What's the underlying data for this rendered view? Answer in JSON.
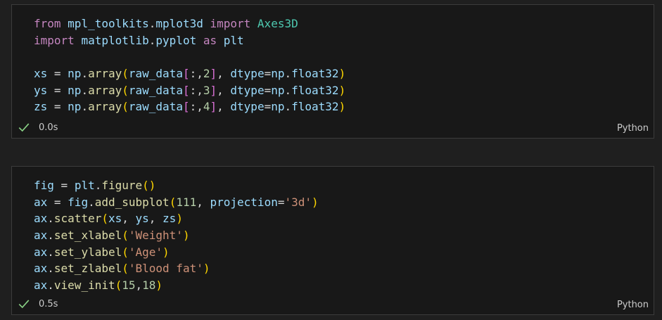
{
  "cells": [
    {
      "lines": [
        [
          [
            "kw",
            "from"
          ],
          [
            "op",
            " "
          ],
          [
            "txt",
            "mpl_toolkits"
          ],
          [
            "op",
            "."
          ],
          [
            "txt",
            "mplot3d"
          ],
          [
            "op",
            " "
          ],
          [
            "kw",
            "import"
          ],
          [
            "op",
            " "
          ],
          [
            "mod",
            "Axes3D"
          ]
        ],
        [
          [
            "kw",
            "import"
          ],
          [
            "op",
            " "
          ],
          [
            "txt",
            "matplotlib"
          ],
          [
            "op",
            "."
          ],
          [
            "txt",
            "pyplot"
          ],
          [
            "op",
            " "
          ],
          [
            "kw",
            "as"
          ],
          [
            "op",
            " "
          ],
          [
            "txt",
            "plt"
          ]
        ],
        [
          [
            "op",
            " "
          ]
        ],
        [
          [
            "txt",
            "xs"
          ],
          [
            "op",
            " = "
          ],
          [
            "txt",
            "np"
          ],
          [
            "op",
            "."
          ],
          [
            "fn",
            "array"
          ],
          [
            "p1",
            "("
          ],
          [
            "txt",
            "raw_data"
          ],
          [
            "p2",
            "["
          ],
          [
            "op",
            ":,"
          ],
          [
            "num",
            "2"
          ],
          [
            "p2",
            "]"
          ],
          [
            "op",
            ", "
          ],
          [
            "txt",
            "dtype"
          ],
          [
            "op",
            "="
          ],
          [
            "txt",
            "np"
          ],
          [
            "op",
            "."
          ],
          [
            "txt",
            "float32"
          ],
          [
            "p1",
            ")"
          ]
        ],
        [
          [
            "txt",
            "ys"
          ],
          [
            "op",
            " = "
          ],
          [
            "txt",
            "np"
          ],
          [
            "op",
            "."
          ],
          [
            "fn",
            "array"
          ],
          [
            "p1",
            "("
          ],
          [
            "txt",
            "raw_data"
          ],
          [
            "p2",
            "["
          ],
          [
            "op",
            ":,"
          ],
          [
            "num",
            "3"
          ],
          [
            "p2",
            "]"
          ],
          [
            "op",
            ", "
          ],
          [
            "txt",
            "dtype"
          ],
          [
            "op",
            "="
          ],
          [
            "txt",
            "np"
          ],
          [
            "op",
            "."
          ],
          [
            "txt",
            "float32"
          ],
          [
            "p1",
            ")"
          ]
        ],
        [
          [
            "txt",
            "zs"
          ],
          [
            "op",
            " = "
          ],
          [
            "txt",
            "np"
          ],
          [
            "op",
            "."
          ],
          [
            "fn",
            "array"
          ],
          [
            "p1",
            "("
          ],
          [
            "txt",
            "raw_data"
          ],
          [
            "p2",
            "["
          ],
          [
            "op",
            ":,"
          ],
          [
            "num",
            "4"
          ],
          [
            "p2",
            "]"
          ],
          [
            "op",
            ", "
          ],
          [
            "txt",
            "dtype"
          ],
          [
            "op",
            "="
          ],
          [
            "txt",
            "np"
          ],
          [
            "op",
            "."
          ],
          [
            "txt",
            "float32"
          ],
          [
            "p1",
            ")"
          ]
        ]
      ],
      "exec_time": "0.0s",
      "language": "Python"
    },
    {
      "lines": [
        [
          [
            "txt",
            "fig"
          ],
          [
            "op",
            " = "
          ],
          [
            "txt",
            "plt"
          ],
          [
            "op",
            "."
          ],
          [
            "fn",
            "figure"
          ],
          [
            "p1",
            "()"
          ]
        ],
        [
          [
            "txt",
            "ax"
          ],
          [
            "op",
            " = "
          ],
          [
            "txt",
            "fig"
          ],
          [
            "op",
            "."
          ],
          [
            "fn",
            "add_subplot"
          ],
          [
            "p1",
            "("
          ],
          [
            "num",
            "111"
          ],
          [
            "op",
            ", "
          ],
          [
            "txt",
            "projection"
          ],
          [
            "op",
            "="
          ],
          [
            "str",
            "'3d'"
          ],
          [
            "p1",
            ")"
          ]
        ],
        [
          [
            "txt",
            "ax"
          ],
          [
            "op",
            "."
          ],
          [
            "fn",
            "scatter"
          ],
          [
            "p1",
            "("
          ],
          [
            "txt",
            "xs"
          ],
          [
            "op",
            ", "
          ],
          [
            "txt",
            "ys"
          ],
          [
            "op",
            ", "
          ],
          [
            "txt",
            "zs"
          ],
          [
            "p1",
            ")"
          ]
        ],
        [
          [
            "txt",
            "ax"
          ],
          [
            "op",
            "."
          ],
          [
            "fn",
            "set_xlabel"
          ],
          [
            "p1",
            "("
          ],
          [
            "str",
            "'Weight'"
          ],
          [
            "p1",
            ")"
          ]
        ],
        [
          [
            "txt",
            "ax"
          ],
          [
            "op",
            "."
          ],
          [
            "fn",
            "set_ylabel"
          ],
          [
            "p1",
            "("
          ],
          [
            "str",
            "'Age'"
          ],
          [
            "p1",
            ")"
          ]
        ],
        [
          [
            "txt",
            "ax"
          ],
          [
            "op",
            "."
          ],
          [
            "fn",
            "set_zlabel"
          ],
          [
            "p1",
            "("
          ],
          [
            "str",
            "'Blood fat'"
          ],
          [
            "p1",
            ")"
          ]
        ],
        [
          [
            "txt",
            "ax"
          ],
          [
            "op",
            "."
          ],
          [
            "fn",
            "view_init"
          ],
          [
            "p1",
            "("
          ],
          [
            "num",
            "15"
          ],
          [
            "op",
            ","
          ],
          [
            "num",
            "18"
          ],
          [
            "p1",
            ")"
          ]
        ]
      ],
      "exec_time": "0.5s",
      "language": "Python"
    }
  ],
  "colors": {
    "success_check": "#89d185",
    "background": "#1f1f1f",
    "cell_background": "#181818"
  },
  "icons": [
    "check-icon"
  ]
}
